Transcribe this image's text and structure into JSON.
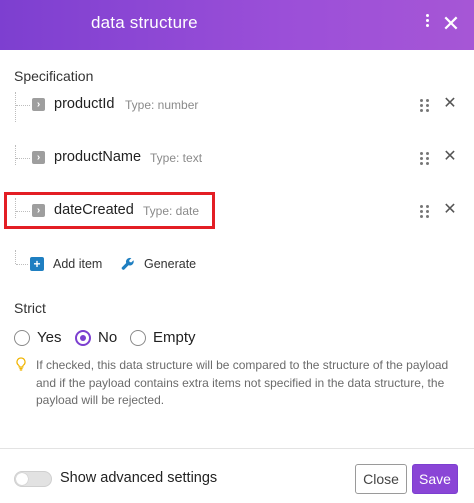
{
  "header": {
    "title": "data structure",
    "menu_icon": "kebab-menu-icon",
    "close_icon": "close-icon"
  },
  "specification": {
    "label": "Specification",
    "items": [
      {
        "name": "productId",
        "type": "Type: number"
      },
      {
        "name": "productName",
        "type": "Type: text"
      },
      {
        "name": "dateCreated",
        "type": "Type: date"
      }
    ],
    "add_item_label": "Add item",
    "generate_label": "Generate"
  },
  "strict": {
    "label": "Strict",
    "options": [
      "Yes",
      "No",
      "Empty"
    ],
    "selected": "No",
    "hint": "If checked, this data structure will be compared to the structure of the payload and if the payload contains extra items not specified in the data structure, the payload will be rejected."
  },
  "footer": {
    "advanced_label": "Show advanced settings",
    "advanced_enabled": false,
    "close_label": "Close",
    "save_label": "Save"
  },
  "colors": {
    "accent": "#7c3fd0",
    "highlight": "#e31e24",
    "add_icon": "#1f7fc1"
  }
}
